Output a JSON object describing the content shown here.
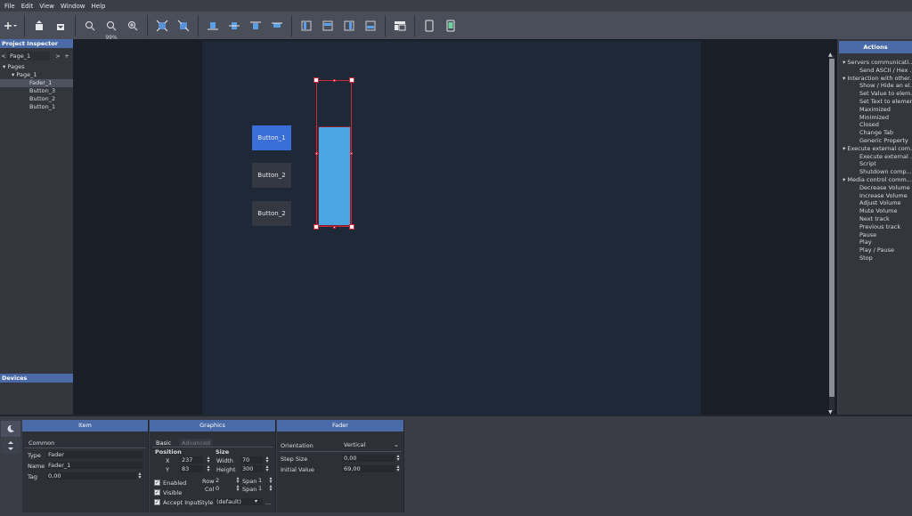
{
  "menu": [
    "File",
    "Edit",
    "View",
    "Window",
    "Help"
  ],
  "toolbar": {
    "zoom_label": "99%"
  },
  "project_inspector": {
    "title": "Project Inspector",
    "page_selector": "Page_1",
    "tree": [
      {
        "label": "Pages",
        "level": 0,
        "expanded": true
      },
      {
        "label": "Page_1",
        "level": 1,
        "expanded": true
      },
      {
        "label": "Fader_1",
        "level": 2,
        "selected": true
      },
      {
        "label": "Button_3",
        "level": 2
      },
      {
        "label": "Button_2",
        "level": 2
      },
      {
        "label": "Button_1",
        "level": 2
      }
    ]
  },
  "devices": {
    "title": "Devices"
  },
  "canvas": {
    "buttons": [
      {
        "label": "Button_1",
        "style": "active"
      },
      {
        "label": "Button_2",
        "style": "normal"
      },
      {
        "label": "Button_2",
        "style": "normal"
      }
    ],
    "fader": {
      "value_fraction": 0.69
    }
  },
  "actions": {
    "title": "Actions",
    "list": [
      {
        "label": "Servers communicati...",
        "type": "cat"
      },
      {
        "label": "Send ASCII / Hex ...",
        "type": "item"
      },
      {
        "label": "Interaction with other...",
        "type": "cat"
      },
      {
        "label": "Show / Hide an el...",
        "type": "item"
      },
      {
        "label": "Set Value to elem...",
        "type": "item"
      },
      {
        "label": "Set Text to element",
        "type": "item"
      },
      {
        "label": "Maximized",
        "type": "item"
      },
      {
        "label": "Minimized",
        "type": "item"
      },
      {
        "label": "Closed",
        "type": "item"
      },
      {
        "label": "Change Tab",
        "type": "item"
      },
      {
        "label": "Generic Property",
        "type": "item"
      },
      {
        "label": "Execute external com...",
        "type": "cat"
      },
      {
        "label": "Execute external ...",
        "type": "item"
      },
      {
        "label": "Script",
        "type": "item"
      },
      {
        "label": "Shutdown comp...",
        "type": "item"
      },
      {
        "label": "Media control comm...",
        "type": "cat"
      },
      {
        "label": "Decrease Volume",
        "type": "item"
      },
      {
        "label": "Increase  Volume",
        "type": "item"
      },
      {
        "label": "Adjust Volume",
        "type": "item"
      },
      {
        "label": "Mute Volume",
        "type": "item"
      },
      {
        "label": "Next track",
        "type": "item"
      },
      {
        "label": "Previous track",
        "type": "item"
      },
      {
        "label": "Pause",
        "type": "item"
      },
      {
        "label": "Play",
        "type": "item"
      },
      {
        "label": "Play / Pause",
        "type": "item"
      },
      {
        "label": "Stop",
        "type": "item"
      }
    ]
  },
  "item_panel": {
    "title": "Item",
    "section": "Common",
    "type_label": "Type",
    "type_value": "Fader",
    "name_label": "Name",
    "name_value": "Fader_1",
    "tag_label": "Tag",
    "tag_value": "0,00"
  },
  "graphics_panel": {
    "title": "Graphics",
    "tab_basic": "Basic",
    "tab_advanced": "Advanced",
    "position_label": "Position",
    "size_label": "Size",
    "x_label": "X",
    "x_value": "237",
    "y_label": "Y",
    "y_value": "83",
    "width_label": "Width",
    "width_value": "70",
    "height_label": "Height",
    "height_value": "300",
    "enabled_label": "Enabled",
    "visible_label": "Visible",
    "accept_input_label": "Accept Input",
    "row_label": "Row",
    "row_value": "2",
    "col_label": "Col",
    "col_value": "0",
    "span_label": "Span",
    "row_span": "1",
    "col_span": "1",
    "style_label": "Style",
    "style_value": "(default)",
    "style_more": "..."
  },
  "fader_panel": {
    "title": "Fader",
    "orientation_label": "Orientation",
    "orientation_value": "Vertical",
    "step_label": "Step Size",
    "step_value": "0,00",
    "initial_label": "Initial Value",
    "initial_value": "69,00"
  }
}
